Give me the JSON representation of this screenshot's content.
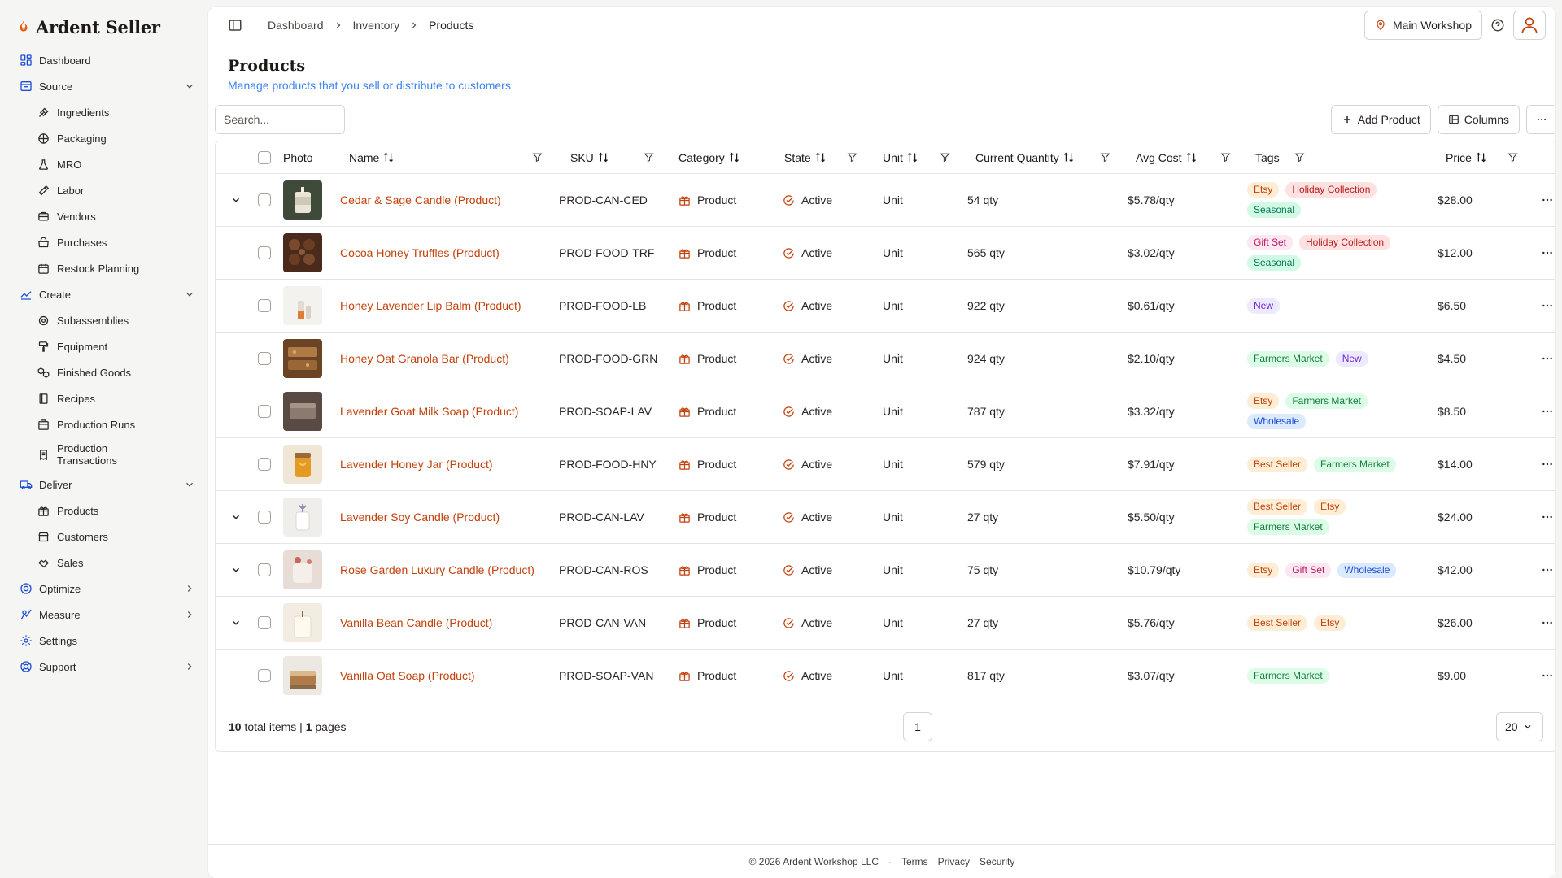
{
  "brand": {
    "name": "Ardent Seller",
    "logo_icon": "flame-icon",
    "accent": "#c2410c"
  },
  "sidebar": {
    "dashboard": "Dashboard",
    "source": {
      "label": "Source",
      "items": [
        "Ingredients",
        "Packaging",
        "MRO",
        "Labor",
        "Vendors",
        "Purchases",
        "Restock Planning"
      ]
    },
    "create": {
      "label": "Create",
      "items": [
        "Subassemblies",
        "Equipment",
        "Finished Goods",
        "Recipes",
        "Production Runs",
        "Production Transactions"
      ]
    },
    "deliver": {
      "label": "Deliver",
      "items": [
        "Products",
        "Customers",
        "Sales"
      ]
    },
    "optimize": "Optimize",
    "measure": "Measure",
    "settings": "Settings",
    "support": "Support"
  },
  "topbar": {
    "breadcrumb": [
      "Dashboard",
      "Inventory",
      "Products"
    ],
    "workshop": "Main Workshop"
  },
  "page": {
    "title": "Products",
    "subtitle": "Manage products that you sell or distribute to customers"
  },
  "toolbar": {
    "search_placeholder": "Search...",
    "add_product": "Add Product",
    "columns": "Columns"
  },
  "table": {
    "headers": {
      "photo": "Photo",
      "name": "Name",
      "sku": "SKU",
      "category": "Category",
      "state": "State",
      "unit": "Unit",
      "quantity": "Current Quantity",
      "cost": "Avg Cost",
      "tags": "Tags",
      "price": "Price"
    },
    "rows": [
      {
        "name": "Cedar & Sage Candle (Product)",
        "sku": "PROD-CAN-CED",
        "category": "Product",
        "state": "Active",
        "unit": "Unit",
        "quantity": "54 qty",
        "cost": "$5.78/qty",
        "tags": [
          "Etsy",
          "Holiday Collection",
          "Seasonal"
        ],
        "price": "$28.00",
        "expandable": true,
        "photo": "candle-jar"
      },
      {
        "name": "Cocoa Honey Truffles (Product)",
        "sku": "PROD-FOOD-TRF",
        "category": "Product",
        "state": "Active",
        "unit": "Unit",
        "quantity": "565 qty",
        "cost": "$3.02/qty",
        "tags": [
          "Gift Set",
          "Holiday Collection",
          "Seasonal"
        ],
        "price": "$12.00",
        "expandable": false,
        "photo": "truffles"
      },
      {
        "name": "Honey Lavender Lip Balm (Product)",
        "sku": "PROD-FOOD-LB",
        "category": "Product",
        "state": "Active",
        "unit": "Unit",
        "quantity": "922 qty",
        "cost": "$0.61/qty",
        "tags": [
          "New"
        ],
        "price": "$6.50",
        "expandable": false,
        "photo": "lip-balm"
      },
      {
        "name": "Honey Oat Granola Bar (Product)",
        "sku": "PROD-FOOD-GRN",
        "category": "Product",
        "state": "Active",
        "unit": "Unit",
        "quantity": "924 qty",
        "cost": "$2.10/qty",
        "tags": [
          "Farmers Market",
          "New"
        ],
        "price": "$4.50",
        "expandable": false,
        "photo": "granola"
      },
      {
        "name": "Lavender Goat Milk Soap (Product)",
        "sku": "PROD-SOAP-LAV",
        "category": "Product",
        "state": "Active",
        "unit": "Unit",
        "quantity": "787 qty",
        "cost": "$3.32/qty",
        "tags": [
          "Etsy",
          "Farmers Market",
          "Wholesale"
        ],
        "price": "$8.50",
        "expandable": false,
        "photo": "soap-dark"
      },
      {
        "name": "Lavender Honey Jar (Product)",
        "sku": "PROD-FOOD-HNY",
        "category": "Product",
        "state": "Active",
        "unit": "Unit",
        "quantity": "579 qty",
        "cost": "$7.91/qty",
        "tags": [
          "Best Seller",
          "Farmers Market"
        ],
        "price": "$14.00",
        "expandable": false,
        "photo": "honey-jar"
      },
      {
        "name": "Lavender Soy Candle (Product)",
        "sku": "PROD-CAN-LAV",
        "category": "Product",
        "state": "Active",
        "unit": "Unit",
        "quantity": "27 qty",
        "cost": "$5.50/qty",
        "tags": [
          "Best Seller",
          "Etsy",
          "Farmers Market"
        ],
        "price": "$24.00",
        "expandable": true,
        "photo": "candle-lavender"
      },
      {
        "name": "Rose Garden Luxury Candle (Product)",
        "sku": "PROD-CAN-ROS",
        "category": "Product",
        "state": "Active",
        "unit": "Unit",
        "quantity": "75 qty",
        "cost": "$10.79/qty",
        "tags": [
          "Etsy",
          "Gift Set",
          "Wholesale"
        ],
        "price": "$42.00",
        "expandable": true,
        "photo": "candle-rose"
      },
      {
        "name": "Vanilla Bean Candle (Product)",
        "sku": "PROD-CAN-VAN",
        "category": "Product",
        "state": "Active",
        "unit": "Unit",
        "quantity": "27 qty",
        "cost": "$5.76/qty",
        "tags": [
          "Best Seller",
          "Etsy"
        ],
        "price": "$26.00",
        "expandable": true,
        "photo": "candle-vanilla"
      },
      {
        "name": "Vanilla Oat Soap (Product)",
        "sku": "PROD-SOAP-VAN",
        "category": "Product",
        "state": "Active",
        "unit": "Unit",
        "quantity": "817 qty",
        "cost": "$3.07/qty",
        "tags": [
          "Farmers Market"
        ],
        "price": "$9.00",
        "expandable": false,
        "photo": "soap-vanilla"
      }
    ]
  },
  "tag_colors": {
    "Etsy": [
      "#ffedd5",
      "#c2410c"
    ],
    "Holiday Collection": [
      "#fee2e2",
      "#b91c1c"
    ],
    "Seasonal": [
      "#d1fae5",
      "#047857"
    ],
    "Gift Set": [
      "#fce7f3",
      "#be185d"
    ],
    "New": [
      "#ede9fe",
      "#6d28d9"
    ],
    "Farmers Market": [
      "#dcfce7",
      "#15803d"
    ],
    "Wholesale": [
      "#dbeafe",
      "#1d4ed8"
    ],
    "Best Seller": [
      "#ffedd5",
      "#c2410c"
    ]
  },
  "pagination": {
    "total_items": "10",
    "total_items_label": "total items",
    "pages": "1",
    "pages_label": "pages",
    "current_page": "1",
    "page_size": "20"
  },
  "footer": {
    "copyright": "© 2026 Ardent Workshop LLC",
    "links": [
      "Terms",
      "Privacy",
      "Security"
    ]
  }
}
